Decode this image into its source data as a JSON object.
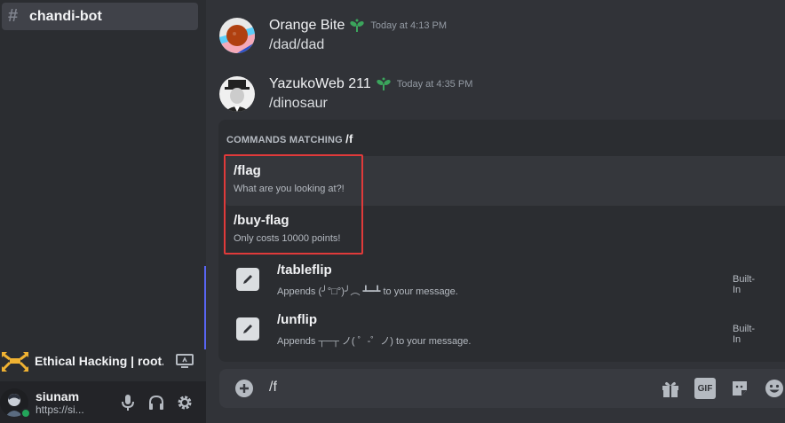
{
  "sidebar": {
    "channel": {
      "name": "chandi-bot"
    },
    "voice": {
      "label": "Ethical Hacking | root..."
    },
    "user": {
      "name": "siunam",
      "status": "https://si..."
    }
  },
  "messages": [
    {
      "username": "Orange Bite",
      "time": "Today at 4:13 PM",
      "text": "/dad/dad"
    },
    {
      "username": "YazukoWeb 211",
      "time": "Today at 4:35 PM",
      "text": "/dinosaur"
    }
  ],
  "autocomplete": {
    "header_prefix": "COMMANDS MATCHING",
    "header_query": "/f",
    "bot_commands": [
      {
        "name": "/flag",
        "description": "What are you looking at?!"
      },
      {
        "name": "/buy-flag",
        "description": "Only costs 10000 points!"
      }
    ],
    "builtin_commands": [
      {
        "name": "/tableflip",
        "description": "Appends (╯°□°)╯︵ ┻━┻ to your message.",
        "source": "Built-In"
      },
      {
        "name": "/unflip",
        "description": "Appends ┬─┬ ノ( ゜-゜ノ) to your message.",
        "source": "Built-In"
      }
    ]
  },
  "composer": {
    "value": "/f"
  },
  "colors": {
    "accent": "#5865f2",
    "highlight_box": "#e03a3a",
    "online": "#23a55a"
  },
  "icons": [
    "hash-icon",
    "network-icon",
    "screen-share-icon",
    "mic-icon",
    "headphones-icon",
    "gear-icon",
    "plus-circle-icon",
    "gift-icon",
    "gif-icon",
    "sticker-icon",
    "emoji-icon",
    "pencil-icon",
    "sprout-badge-icon"
  ]
}
